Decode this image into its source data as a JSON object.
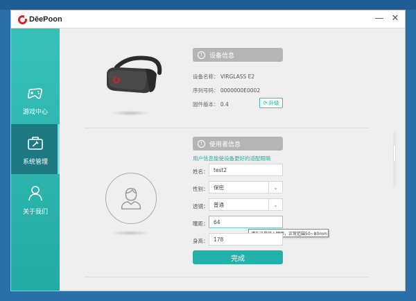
{
  "app": {
    "brand": "DēePoon"
  },
  "sidebar": {
    "items": [
      {
        "label": "游戏中心",
        "icon": "gamepad-icon"
      },
      {
        "label": "系统管理",
        "icon": "toolbox-icon",
        "active": true
      },
      {
        "label": "关于我们",
        "icon": "person-icon"
      }
    ]
  },
  "device": {
    "header": "设备信息",
    "name_label": "设备名称：",
    "name_value": "VIRGLASS E2",
    "serial_label": "序列号码：",
    "serial_value": "0000000E0002",
    "firmware_label": "固件版本：",
    "firmware_value": "0.4",
    "upgrade_label": "升级"
  },
  "user": {
    "header": "使用者信息",
    "hint": "用户信息能使设备更好的适配眼睛",
    "name_label": "姓名：",
    "name_value": "test2",
    "gender_label": "性别：",
    "gender_value": "保密",
    "lens_label": "透镜：",
    "lens_value": "普通",
    "ipd_label": "瞳距：",
    "ipd_value": "64",
    "height_label": "身高：",
    "height_value": "178",
    "tooltip": "请在这里输入瞳距，正常范围50~80mm",
    "done_label": "完成"
  },
  "colors": {
    "accent": "#22b2aa",
    "sidebar_active": "#1c7a80",
    "brand_red": "#d0242b"
  }
}
